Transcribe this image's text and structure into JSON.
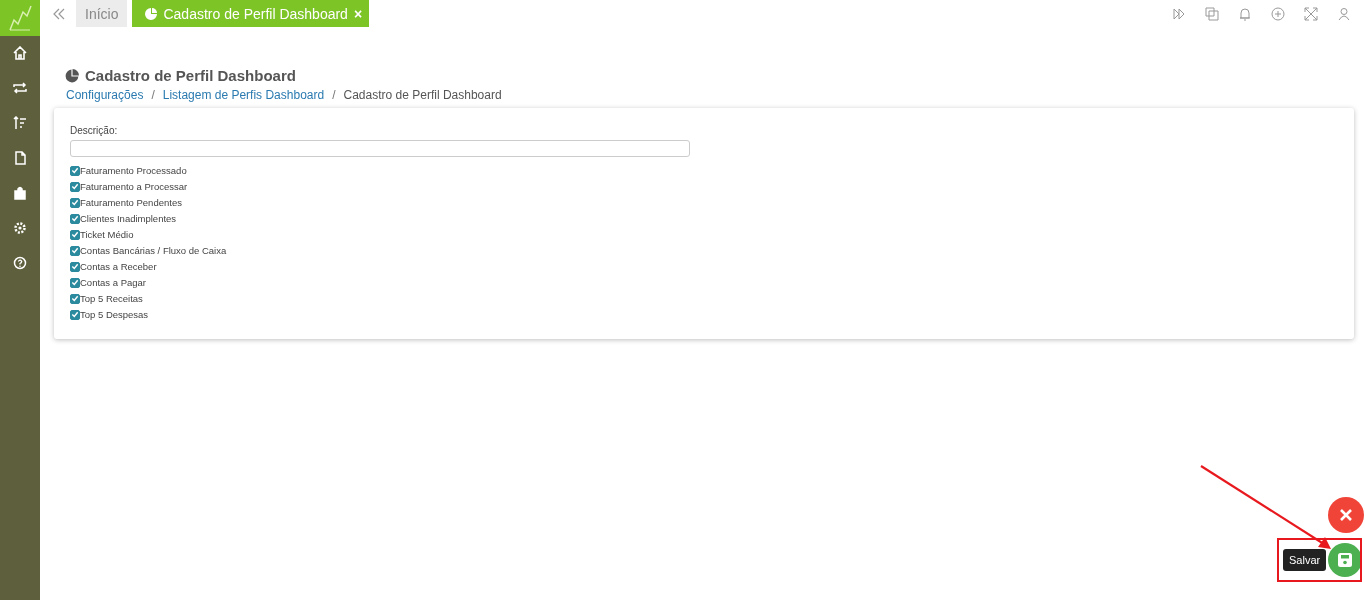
{
  "tabs": [
    {
      "label": "Início",
      "selected": false,
      "closable": false
    },
    {
      "label": "Cadastro de Perfil Dashboard",
      "selected": true,
      "closable": true,
      "close": "×"
    }
  ],
  "page": {
    "title": "Cadastro de Perfil Dashboard",
    "breadcrumb": [
      {
        "label": "Configurações",
        "link": true
      },
      {
        "label": "Listagem de Perfis Dashboard",
        "link": true
      },
      {
        "label": "Cadastro de Perfil Dashboard",
        "link": false
      }
    ],
    "separator": "/"
  },
  "form": {
    "description_label": "Descrição:",
    "options": [
      {
        "label": "Faturamento Processado",
        "checked": true
      },
      {
        "label": "Faturamento a Processar",
        "checked": true
      },
      {
        "label": "Faturamento Pendentes",
        "checked": true
      },
      {
        "label": "Clientes Inadimplentes",
        "checked": true
      },
      {
        "label": "Ticket Médio",
        "checked": true
      },
      {
        "label": "Contas Bancárias / Fluxo de Caixa",
        "checked": true
      },
      {
        "label": "Contas a Receber",
        "checked": true
      },
      {
        "label": "Contas a Pagar",
        "checked": true
      },
      {
        "label": "Top 5 Receitas",
        "checked": true
      },
      {
        "label": "Top 5 Despesas",
        "checked": true
      }
    ]
  },
  "save_tooltip": "Salvar"
}
